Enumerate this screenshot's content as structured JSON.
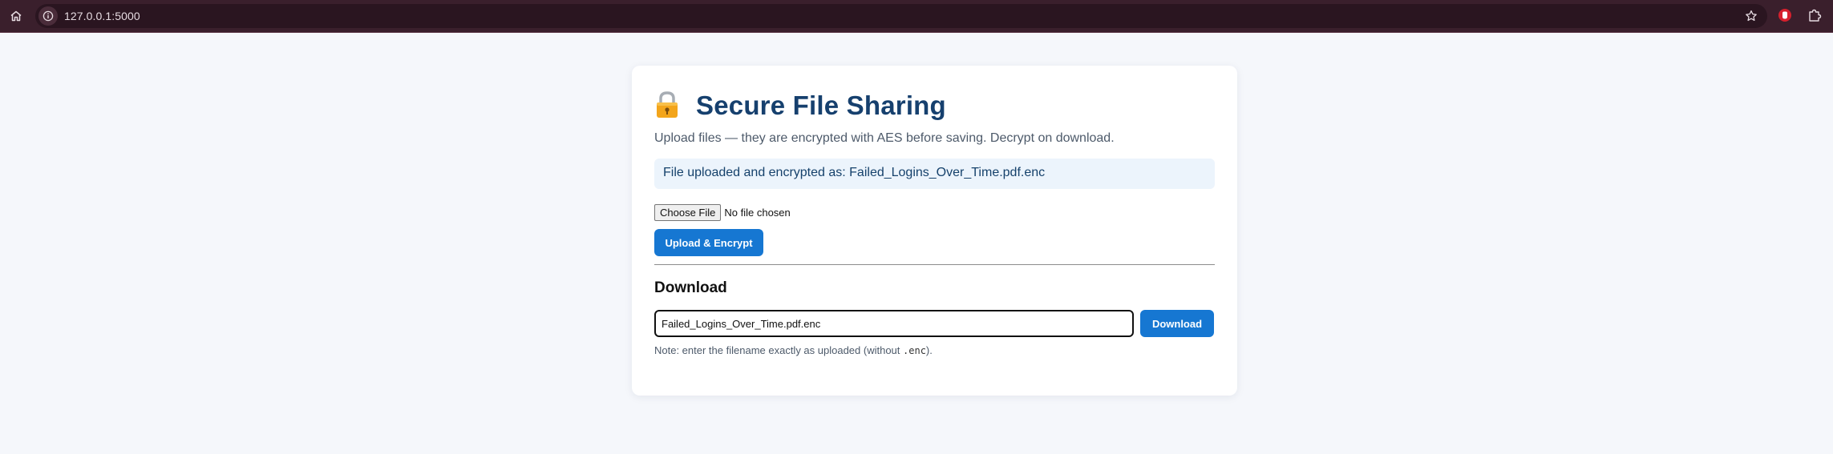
{
  "browser": {
    "url": "127.0.0.1:5000",
    "icons": [
      "home-icon",
      "site-info-icon",
      "bookmark-star-icon",
      "extension-icon",
      "puzzle-extensions-icon"
    ]
  },
  "page": {
    "title": "Secure File Sharing",
    "title_icon": "lock-icon",
    "subtitle": "Upload files — they are encrypted with AES before saving. Decrypt on download.",
    "flash_message": "File uploaded and encrypted as: Failed_Logins_Over_Time.pdf.enc",
    "upload": {
      "choose_label": "Choose File",
      "no_file_text": "No file chosen",
      "button_label": "Upload & Encrypt"
    },
    "download": {
      "heading": "Download",
      "input_value": "Failed_Logins_Over_Time.pdf.enc",
      "button_label": "Download",
      "note_prefix": "Note: enter the filename exactly as uploaded (without ",
      "note_code": ".enc",
      "note_suffix": ")."
    }
  },
  "colors": {
    "chrome_bg": "#3a1f2c",
    "page_bg": "#f5f7fb",
    "title": "#16406e",
    "button": "#1677d2",
    "flash_bg": "#ecf4fc"
  }
}
